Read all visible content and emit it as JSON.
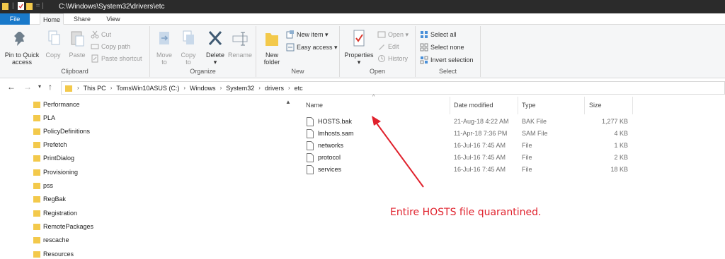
{
  "window": {
    "title": "C:\\Windows\\System32\\drivers\\etc"
  },
  "tabs": {
    "file": "File",
    "home": "Home",
    "share": "Share",
    "view": "View"
  },
  "ribbon": {
    "clipboard": {
      "label": "Clipboard",
      "pin": "Pin to Quick\naccess",
      "pin_line1": "Pin to Quick",
      "pin_line2": "access",
      "copy": "Copy",
      "paste": "Paste",
      "cut": "Cut",
      "copy_path": "Copy path",
      "paste_shortcut": "Paste shortcut"
    },
    "organize": {
      "label": "Organize",
      "move_to_1": "Move",
      "move_to_2": "to",
      "copy_to_1": "Copy",
      "copy_to_2": "to",
      "delete": "Delete",
      "rename": "Rename"
    },
    "new": {
      "label": "New",
      "new_folder_1": "New",
      "new_folder_2": "folder",
      "new_item": "New item",
      "easy_access": "Easy access"
    },
    "open": {
      "label": "Open",
      "properties": "Properties",
      "open": "Open",
      "edit": "Edit",
      "history": "History"
    },
    "select": {
      "label": "Select",
      "select_all": "Select all",
      "select_none": "Select none",
      "invert": "Invert selection"
    }
  },
  "address": {
    "crumbs": [
      "This PC",
      "TomsWin10ASUS (C:)",
      "Windows",
      "System32",
      "drivers",
      "etc"
    ]
  },
  "navpane": {
    "items": [
      "Performance",
      "PLA",
      "PolicyDefinitions",
      "Prefetch",
      "PrintDialog",
      "Provisioning",
      "pss",
      "RegBak",
      "Registration",
      "RemotePackages",
      "rescache",
      "Resources"
    ]
  },
  "filelist": {
    "columns": {
      "name": "Name",
      "date": "Date modified",
      "type": "Type",
      "size": "Size"
    },
    "rows": [
      {
        "name": "HOSTS.bak",
        "date": "21-Aug-18 4:22 AM",
        "type": "BAK File",
        "size": "1,277 KB"
      },
      {
        "name": "lmhosts.sam",
        "date": "11-Apr-18 7:36 PM",
        "type": "SAM File",
        "size": "4 KB"
      },
      {
        "name": "networks",
        "date": "16-Jul-16 7:45 AM",
        "type": "File",
        "size": "1 KB"
      },
      {
        "name": "protocol",
        "date": "16-Jul-16 7:45 AM",
        "type": "File",
        "size": "2 KB"
      },
      {
        "name": "services",
        "date": "16-Jul-16 7:45 AM",
        "type": "File",
        "size": "18 KB"
      }
    ]
  },
  "annotation": {
    "text": "Entire HOSTS file quarantined.",
    "color": "#e0212c"
  },
  "colors": {
    "accent": "#1979ca",
    "folder": "#f3c94b",
    "titlebar": "#2b2b2b"
  }
}
